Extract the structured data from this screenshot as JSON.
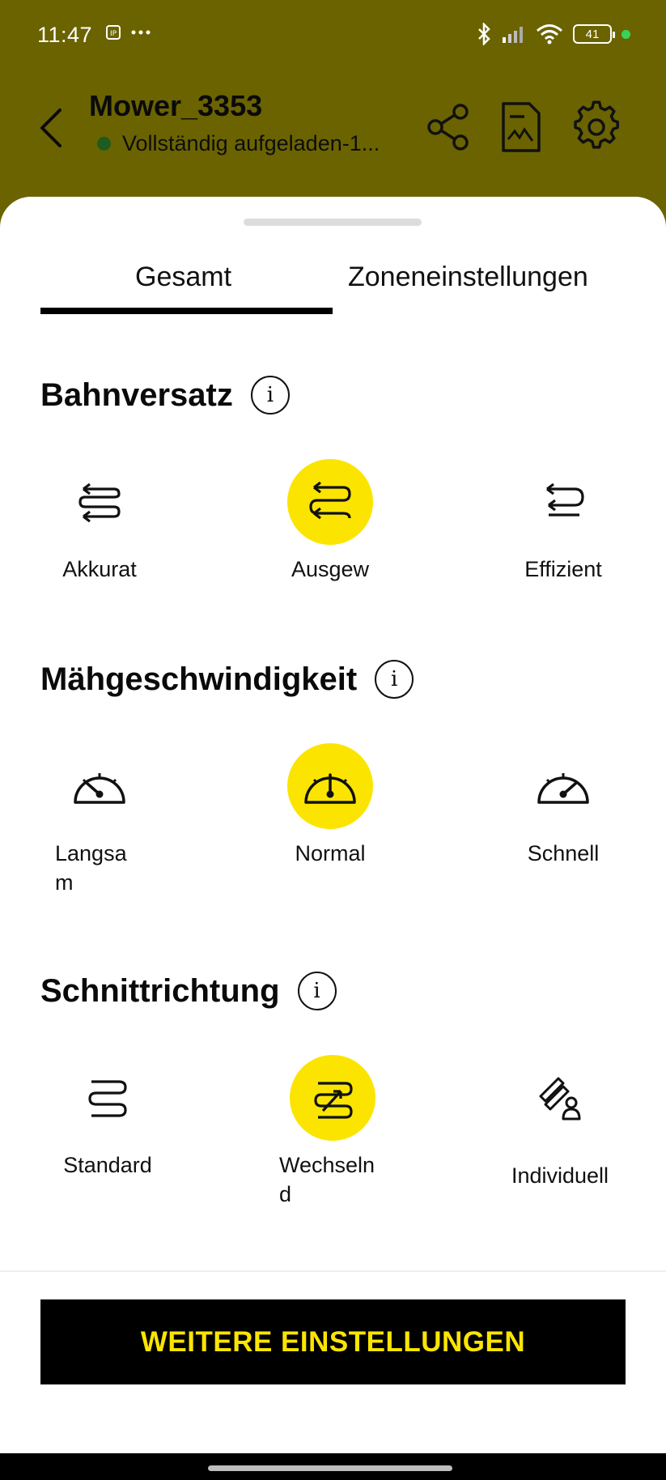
{
  "status_bar": {
    "time": "11:47",
    "battery": "41"
  },
  "header": {
    "title": "Mower_3353",
    "status": "Vollständig aufgeladen-1..."
  },
  "tabs": [
    {
      "label": "Gesamt",
      "active": true
    },
    {
      "label": "Zoneneinstellungen",
      "active": false
    }
  ],
  "sections": {
    "bahnversatz": {
      "title": "Bahnversatz",
      "options": [
        {
          "label": "Akkurat",
          "selected": false
        },
        {
          "label": "Ausgew",
          "selected": true
        },
        {
          "label": "Effizient",
          "selected": false
        }
      ]
    },
    "maehgeschwindigkeit": {
      "title": "Mähgeschwindigkeit",
      "options": [
        {
          "label": "Langsa\nm",
          "selected": false
        },
        {
          "label": "Normal",
          "selected": true
        },
        {
          "label": "Schnell",
          "selected": false
        }
      ]
    },
    "schnittrichtung": {
      "title": "Schnittrichtung",
      "options": [
        {
          "label": "Standard",
          "selected": false
        },
        {
          "label": "Wechseln\nd",
          "selected": true
        },
        {
          "label": "Individuell",
          "selected": false
        }
      ]
    }
  },
  "footer": {
    "button_label": "WEITERE EINSTELLUNGEN"
  },
  "colors": {
    "header_bg": "#6b6300",
    "accent_yellow": "#fbe500",
    "status_dot": "#1e5b1e"
  }
}
